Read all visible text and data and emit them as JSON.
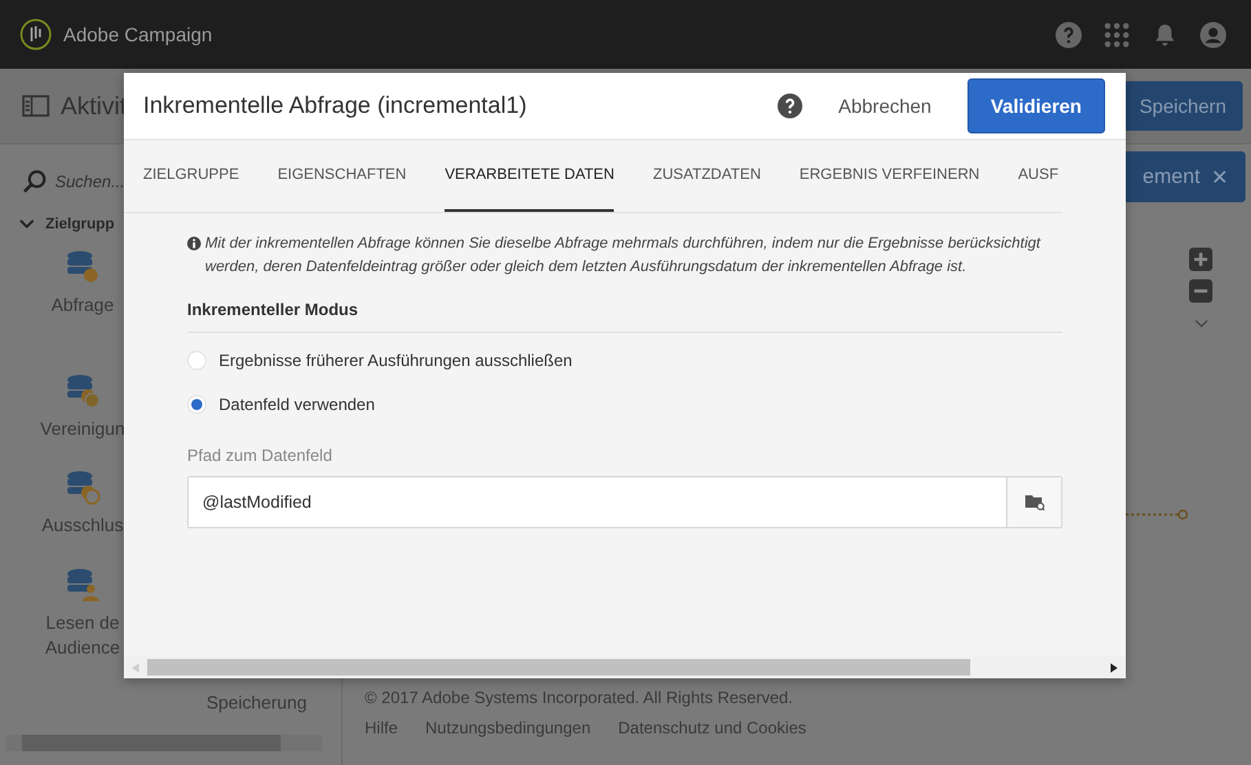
{
  "app_bar": {
    "title": "Adobe Campaign"
  },
  "toolbar": {
    "title": "Aktivit",
    "save": "Speichern",
    "close_panel": "ement",
    "close_symbol": "✕"
  },
  "sidebar": {
    "search_placeholder": "Suchen...",
    "group": "Zielgrupp",
    "items": [
      {
        "label": "Abfrage",
        "kind": "query"
      },
      {
        "label": "Vereinigun",
        "kind": "union"
      },
      {
        "label": "Ausschlus",
        "kind": "exclusion"
      },
      {
        "label": "Lesen de\nAudience",
        "kind": "audience"
      }
    ],
    "extra_label": "Speicherung"
  },
  "footer": {
    "copyright": "© 2017 Adobe Systems Incorporated. All Rights Reserved.",
    "links": [
      "Hilfe",
      "Nutzungsbedingungen",
      "Datenschutz und Cookies"
    ]
  },
  "dialog": {
    "title": "Inkrementelle Abfrage (incremental1)",
    "cancel": "Abbrechen",
    "confirm": "Validieren",
    "tabs": [
      {
        "label": "ZIELGRUPPE",
        "selected": false
      },
      {
        "label": "EIGENSCHAFTEN",
        "selected": false
      },
      {
        "label": "VERARBEITETE DATEN",
        "selected": true
      },
      {
        "label": "ZUSATZDATEN",
        "selected": false
      },
      {
        "label": "ERGEBNIS VERFEINERN",
        "selected": false
      },
      {
        "label": "AUSF",
        "selected": false
      }
    ],
    "info": "Mit der inkrementellen Abfrage können Sie dieselbe Abfrage mehrmals durchführen, indem nur die Ergebnisse berücksichtigt werden, deren Datenfeldeintrag größer oder gleich dem letzten Ausführungsdatum der inkrementellen Abfrage ist.",
    "section": "Inkrementeller Modus",
    "options": [
      {
        "label": "Ergebnisse früherer Ausführungen ausschließen",
        "selected": false
      },
      {
        "label": "Datenfeld verwenden",
        "selected": true
      }
    ],
    "field": {
      "label": "Pfad zum Datenfeld",
      "value": "@lastModified"
    }
  }
}
